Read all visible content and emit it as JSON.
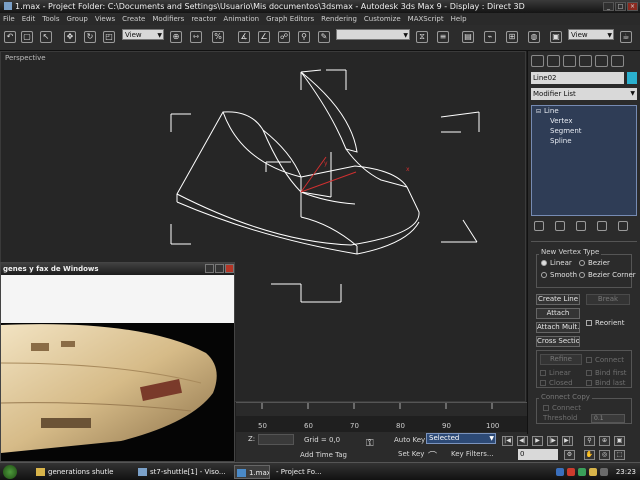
{
  "window": {
    "title": "1.max    - Project Folder: C:\\Documents and Settings\\Usuario\\Mis documentos\\3dsmax    - Autodesk 3ds Max 9    - Display : Direct 3D"
  },
  "menu": [
    "File",
    "Edit",
    "Tools",
    "Group",
    "Views",
    "Create",
    "Modifiers",
    "reactor",
    "Animation",
    "Graph Editors",
    "Rendering",
    "Customize",
    "MAXScript",
    "Help"
  ],
  "toolbar": {
    "ref_coord": "View",
    "named_sel": "",
    "view_select2": "View"
  },
  "viewport": {
    "label": "Perspective"
  },
  "command_panel": {
    "object_name": "Line02",
    "object_color": "#2ab0ce",
    "modifier_list": "Modifier List",
    "stack": {
      "root": "Line",
      "items": [
        "Vertex",
        "Segment",
        "Spline"
      ]
    },
    "new_vertex_type": {
      "title": "New Vertex Type",
      "linear": "Linear",
      "bezier": "Bezier",
      "smooth": "Smooth",
      "bezier_corner": "Bezier Corner"
    },
    "buttons": {
      "create_line": "Create Line",
      "break": "Break",
      "attach": "Attach",
      "reorient": "Reorient",
      "attach_mult": "Attach Mult.",
      "cross_section": "Cross Section",
      "refine": "Refine",
      "connect": "Connect",
      "linear": "Linear",
      "bind_first": "Bind first",
      "closed": "Closed",
      "bind_last": "Bind last"
    },
    "connect_copy": {
      "title": "Connect Copy",
      "connect": "Connect",
      "threshold_label": "Threshold",
      "threshold_value": "0.1"
    }
  },
  "reference_window": {
    "title": "genes y fax de Windows"
  },
  "timeline": {
    "ticks": [
      "50",
      "60",
      "70",
      "80",
      "90",
      "100"
    ]
  },
  "status": {
    "z_label": "Z:",
    "grid": "Grid = 0,0",
    "add_time_tag": "Add Time Tag",
    "auto_key": "Auto Key",
    "selected": "Selected",
    "set_key": "Set Key",
    "key_filters": "Key Filters...",
    "frame": "0"
  },
  "taskbar": {
    "items": [
      "generations shutle",
      "st7-shuttle[1] - Viso...",
      "1.max",
      "- Project Fo..."
    ],
    "clock": "23:23"
  }
}
